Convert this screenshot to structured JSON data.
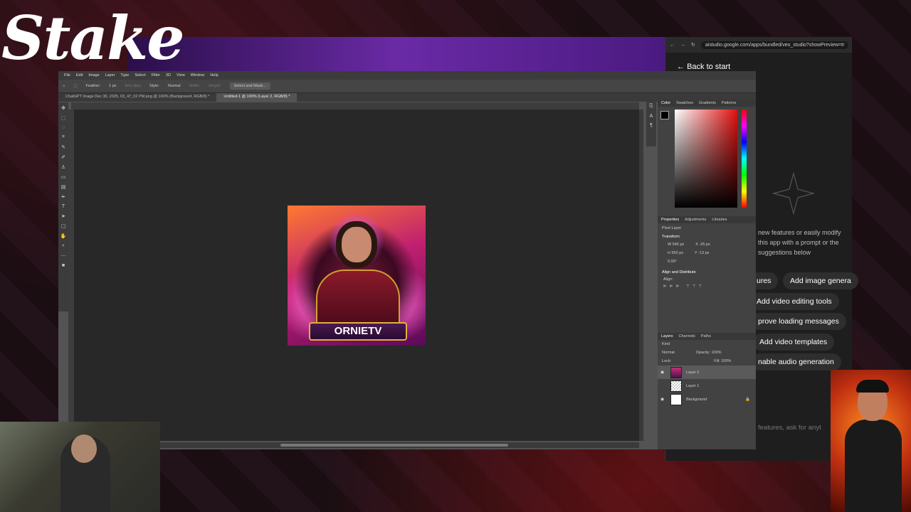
{
  "overlay": {
    "brand": "Stake"
  },
  "browser": {
    "url": "aistudio.google.com/apps/bundled/veo_studio?showPreview=tr",
    "back_label": "Back to start",
    "message": "new features or easily modify this app with a prompt or the suggestions below",
    "suggestions": [
      "ures",
      "Add image genera",
      "Add video editing tools",
      "prove loading messages",
      "Add video templates",
      "nable audio generation"
    ],
    "input_placeholder": "features, ask for anyt"
  },
  "photoshop": {
    "menu": [
      "File",
      "Edit",
      "Image",
      "Layer",
      "Type",
      "Select",
      "Filter",
      "3D",
      "View",
      "Window",
      "Help"
    ],
    "options": {
      "feather_label": "Feather:",
      "feather_value": "1 px",
      "anti_alias": "Anti-alias",
      "style_label": "Style:",
      "style_value": "Normal",
      "width_label": "Width:",
      "height_label": "Height:",
      "select_mask": "Select and Mask..."
    },
    "tabs": [
      "ChatGPT Image Dec 30, 2025, 03_47_02 PM.png @ 100% (Background, RGB/8) *",
      "Untitled-1 @ 100% (Layer 2, RGB/8) *"
    ],
    "artwork_text": "ORNIETV",
    "color_tabs": [
      "Color",
      "Swatches",
      "Gradients",
      "Patterns"
    ],
    "properties_tabs": [
      "Properties",
      "Adjustments",
      "Libraries"
    ],
    "properties": {
      "kind": "Pixel Layer",
      "section": "Transform",
      "w": "546 px",
      "h": "550 px",
      "x": "-25 px",
      "y": "-13 px",
      "angle": "0.00°",
      "align": "Align and Distribute",
      "align_sub": "Align:"
    },
    "layers_tabs": [
      "Layers",
      "Channels",
      "Paths"
    ],
    "layers_controls": {
      "filter": "Kind",
      "blend": "Normal",
      "opacity_label": "Opacity:",
      "opacity": "100%",
      "lock_label": "Lock:",
      "fill_label": "Fill:",
      "fill": "100%"
    },
    "layers": [
      "Layer 2",
      "Layer 1",
      "Background"
    ]
  }
}
